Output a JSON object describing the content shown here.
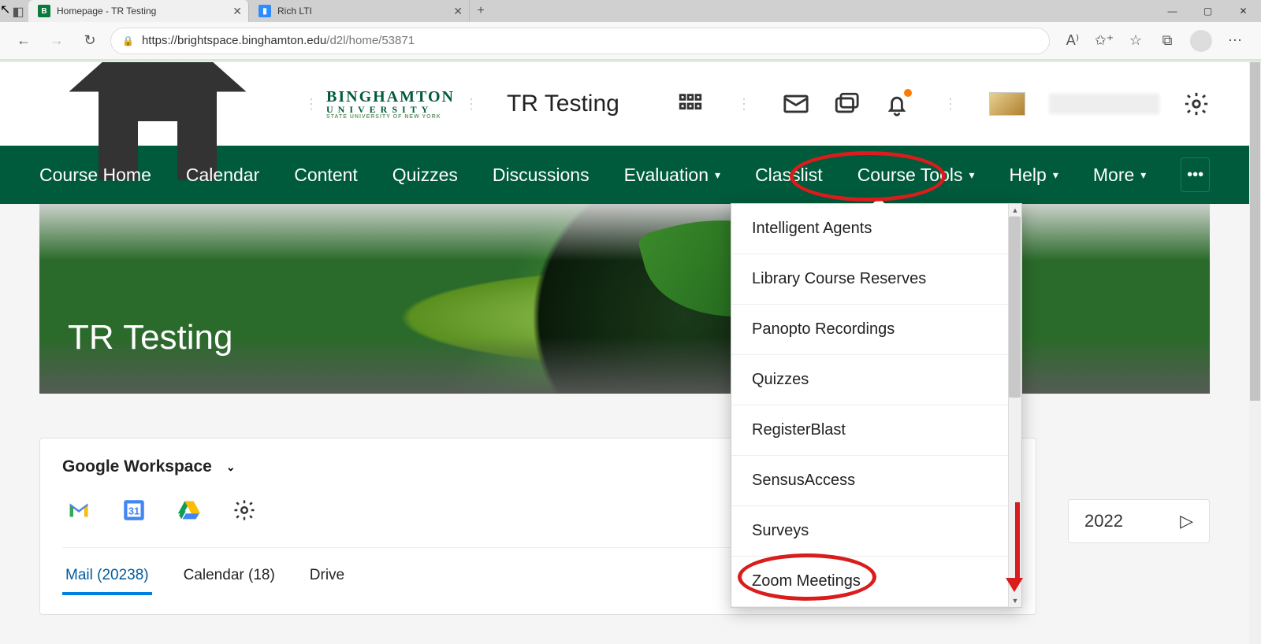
{
  "browser": {
    "tabs": [
      {
        "title": "Homepage - TR Testing",
        "favicon_bg": "#0a7a3a",
        "favicon_text": "B",
        "favicon_color": "#fff"
      },
      {
        "title": "Rich LTI",
        "favicon_bg": "#2d8cff",
        "favicon_text": "▮",
        "favicon_color": "#fff"
      }
    ],
    "url_host": "https://brightspace.binghamton.edu",
    "url_path": "/d2l/home/53871"
  },
  "header": {
    "logo_line1": "BINGHAMTON",
    "logo_line2": "UNIVERSITY",
    "logo_line3": "STATE UNIVERSITY OF NEW YORK",
    "course_title": "TR Testing"
  },
  "nav": {
    "items": [
      {
        "label": "Course Home",
        "has_caret": false
      },
      {
        "label": "Calendar",
        "has_caret": false
      },
      {
        "label": "Content",
        "has_caret": false
      },
      {
        "label": "Quizzes",
        "has_caret": false
      },
      {
        "label": "Discussions",
        "has_caret": false
      },
      {
        "label": "Evaluation",
        "has_caret": true
      },
      {
        "label": "Classlist",
        "has_caret": false
      },
      {
        "label": "Course Tools",
        "has_caret": true
      },
      {
        "label": "Help",
        "has_caret": true
      },
      {
        "label": "More",
        "has_caret": true
      }
    ]
  },
  "dropdown": {
    "items": [
      "Intelligent Agents",
      "Library Course Reserves",
      "Panopto Recordings",
      "Quizzes",
      "RegisterBlast",
      "SensusAccess",
      "Surveys",
      "Zoom Meetings"
    ],
    "highlighted_index": 7
  },
  "banner": {
    "title": "TR Testing"
  },
  "google_workspace": {
    "title": "Google Workspace",
    "tabs": [
      {
        "label": "Mail (20238)",
        "active": true
      },
      {
        "label": "Calendar (18)",
        "active": false
      },
      {
        "label": "Drive",
        "active": false
      }
    ]
  },
  "calendar_widget": {
    "year": "2022"
  }
}
